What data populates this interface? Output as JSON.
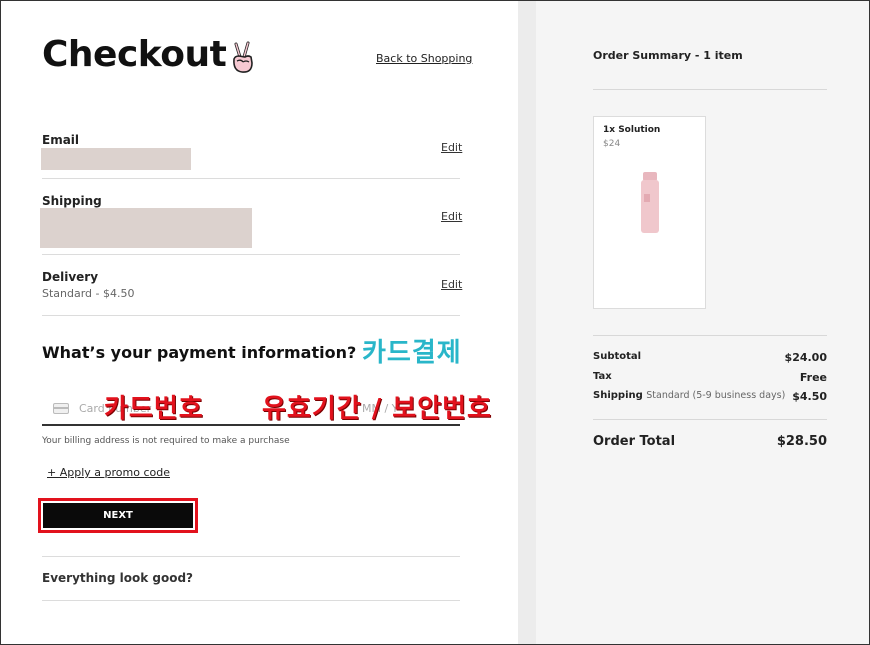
{
  "checkout": {
    "title": "Checkout",
    "back_link": "Back to Shopping",
    "email": {
      "label": "Email",
      "edit": "Edit"
    },
    "shipping": {
      "label": "Shipping",
      "edit": "Edit"
    },
    "delivery": {
      "label": "Delivery",
      "value": "Standard - $4.50",
      "edit": "Edit"
    },
    "payment": {
      "heading": "What’s your payment information?",
      "card_placeholder": "Card number",
      "expiry_placeholder": "MM / Y",
      "billing_note": "Your billing address is not required to make a purchase",
      "promo_link": "+ Apply a promo code",
      "next_button": "NEXT"
    },
    "review_heading": "Everything look good?"
  },
  "annotations": {
    "card_payment": "카드결제",
    "card_number": "카드번호",
    "expiry_security": "유효기간 / 보안번호",
    "colors": {
      "teal": "#29b6c9",
      "red": "#e2121d"
    }
  },
  "order_summary": {
    "title": "Order Summary - 1 item",
    "item": {
      "name": "1x Solution",
      "price": "$24"
    },
    "subtotal": {
      "label": "Subtotal",
      "value": "$24.00"
    },
    "tax": {
      "label": "Tax",
      "value": "Free"
    },
    "shipping": {
      "label": "Shipping",
      "detail": "Standard (5-9 business days)",
      "value": "$4.50"
    },
    "total": {
      "label": "Order Total",
      "value": "$28.50"
    }
  }
}
